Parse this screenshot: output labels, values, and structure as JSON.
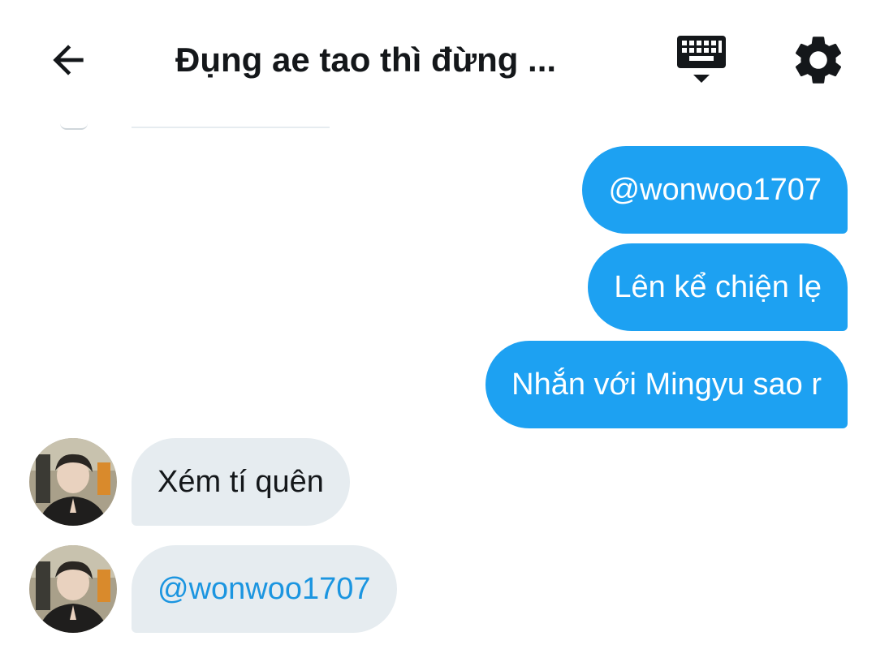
{
  "header": {
    "title": "Đụng ae tao thì đừng ...",
    "back_icon": "arrow-left-icon",
    "keyboard_icon": "keyboard-hide-icon",
    "settings_icon": "gear-icon"
  },
  "messages_outgoing": [
    {
      "text": "@wonwoo1707"
    },
    {
      "text": "Lên kể chiện lẹ"
    },
    {
      "text": "Nhắn với Mingyu sao r"
    }
  ],
  "messages_incoming": [
    {
      "text": "Xém tí quên"
    },
    {
      "text": "@wonwoo1707"
    }
  ],
  "colors": {
    "outgoing_bubble": "#1da1f2",
    "incoming_bubble": "#e6ecf0",
    "mention_link": "#1b95e0",
    "text": "#14171a"
  }
}
